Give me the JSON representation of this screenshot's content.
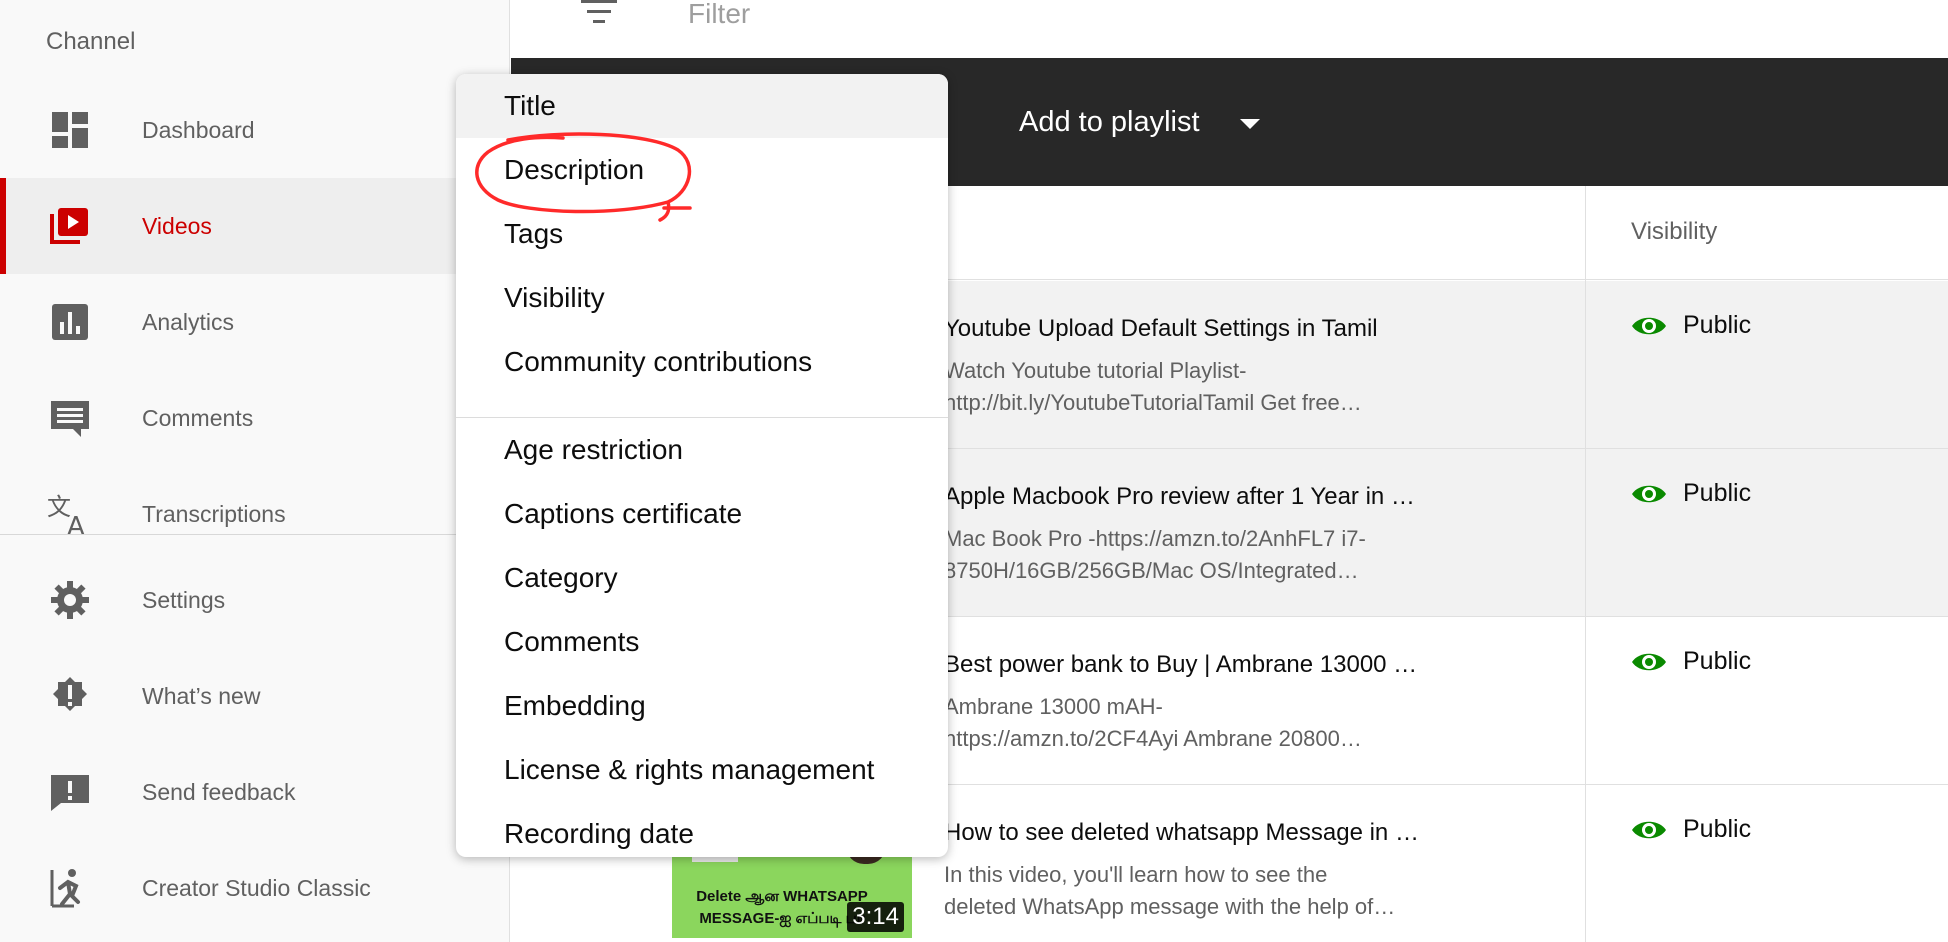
{
  "sidebar": {
    "heading": "Channel",
    "items": [
      {
        "label": "Dashboard",
        "icon": "dashboard-icon"
      },
      {
        "label": "Videos",
        "icon": "videos-icon",
        "active": true
      },
      {
        "label": "Analytics",
        "icon": "analytics-icon"
      },
      {
        "label": "Comments",
        "icon": "comments-icon"
      },
      {
        "label": "Transcriptions",
        "icon": "translate-icon"
      },
      {
        "label": "Settings",
        "icon": "gear-icon"
      },
      {
        "label": "What’s new",
        "icon": "whats-new-icon"
      },
      {
        "label": "Send feedback",
        "icon": "feedback-icon"
      },
      {
        "label": "Creator Studio Classic",
        "icon": "exit-icon"
      }
    ]
  },
  "filter": {
    "placeholder": "Filter"
  },
  "action_bar": {
    "add_to_playlist": "Add to playlist"
  },
  "table": {
    "visibility_header": "Visibility",
    "rows": [
      {
        "title": "Youtube Upload Default Settings in Tamil",
        "desc1": "Watch Youtube tutorial Playlist-",
        "desc2": "http://bit.ly/YoutubeTutorialTamil Get free…",
        "visibility": "Public"
      },
      {
        "title": "Apple Macbook Pro review after 1 Year in …",
        "desc1": "Mac Book Pro -https://amzn.to/2AnhFL7 i7-",
        "desc2": "8750H/16GB/256GB/Mac OS/Integrated…",
        "visibility": "Public"
      },
      {
        "title": "Best power bank to Buy | Ambrane 13000 …",
        "desc1": "Ambrane 13000 mAH-",
        "desc2": "https://amzn.to/2CF4Ayi Ambrane 20800…",
        "visibility": "Public"
      },
      {
        "title": "How to see deleted whatsapp Message in …",
        "desc1": "In this video, you'll learn how to see the",
        "desc2": "deleted WhatsApp message with the help of…",
        "visibility": "Public"
      }
    ],
    "thumbnail": {
      "text": "Delete ஆன WHATSAPP MESSAGE-ஐ எப்படி பா",
      "duration": "3:14"
    }
  },
  "dropdown": {
    "items": [
      "Title",
      "Description",
      "Tags",
      "Visibility",
      "Community contributions",
      "Age restriction",
      "Captions certificate",
      "Category",
      "Comments",
      "Embedding",
      "License & rights management",
      "Recording date"
    ],
    "highlighted": "Title",
    "annotated": "Description"
  },
  "colors": {
    "accent": "#cc0000",
    "public_eye": "#0a8a00",
    "action_bar": "#282828",
    "annotation": "#ff2a2a"
  }
}
